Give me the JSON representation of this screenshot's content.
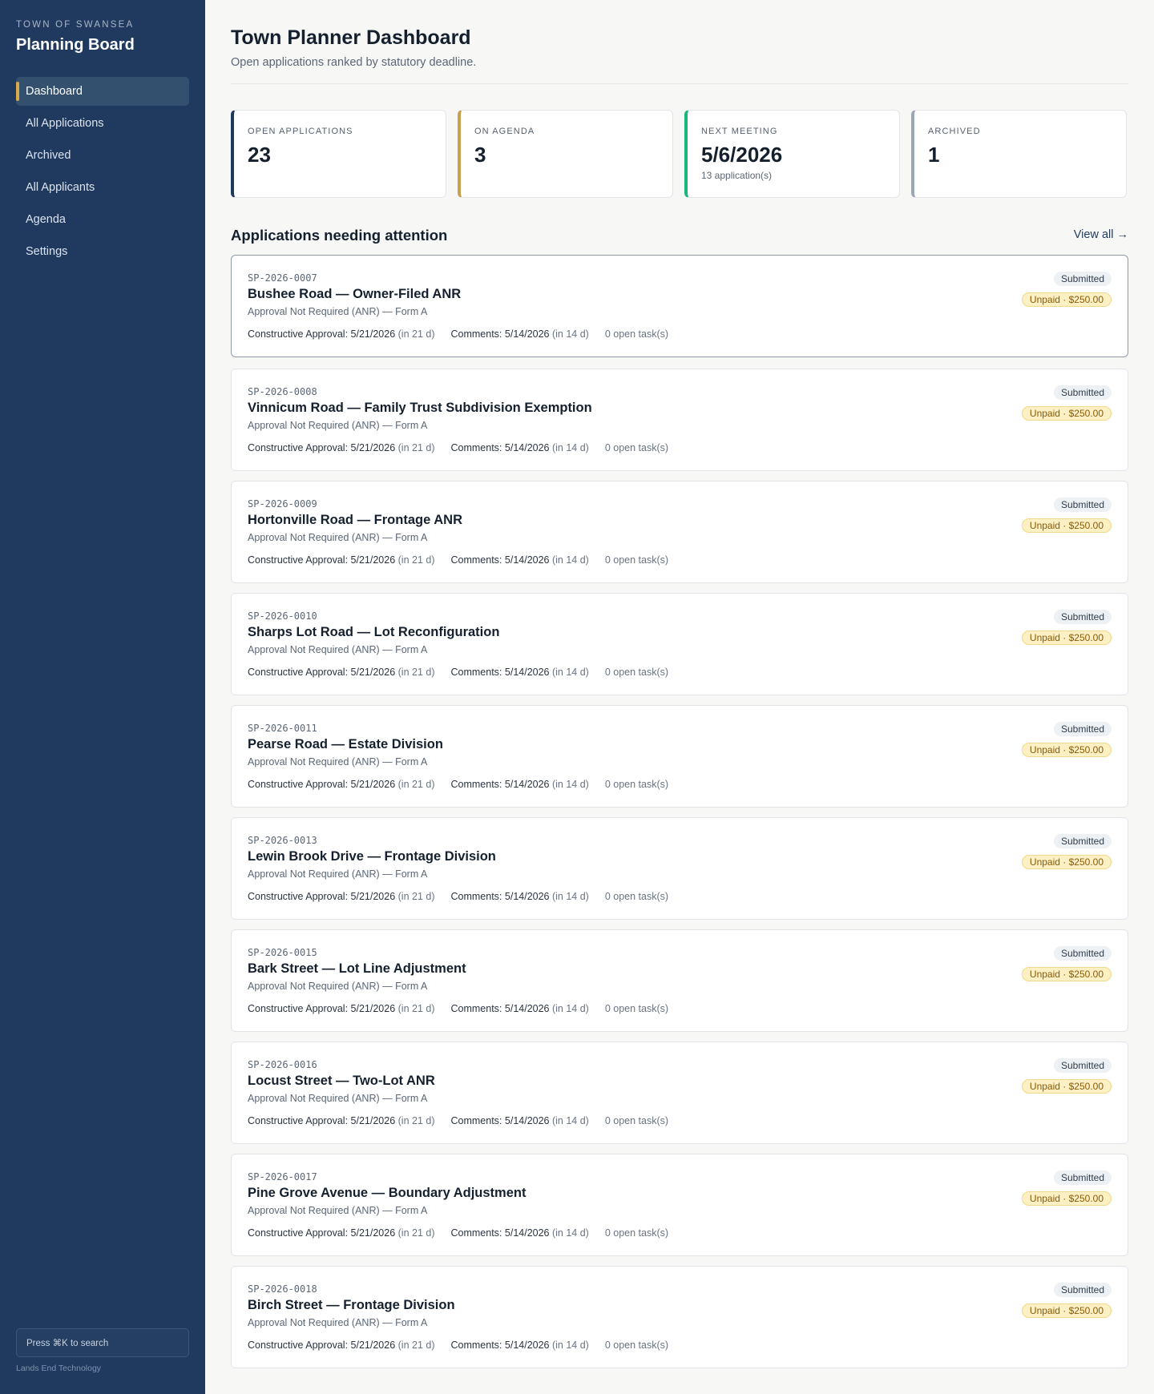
{
  "sidebar": {
    "eyebrow": "TOWN OF SWANSEA",
    "title": "Planning Board",
    "nav": [
      {
        "label": "Dashboard",
        "active": true
      },
      {
        "label": "All Applications"
      },
      {
        "label": "Archived"
      },
      {
        "label": "All Applicants"
      },
      {
        "label": "Agenda"
      },
      {
        "label": "Settings"
      }
    ],
    "search_hint": "Press ⌘K to search",
    "footer": "Lands End Technology"
  },
  "header": {
    "title": "Town Planner Dashboard",
    "subtitle": "Open applications ranked by statutory deadline."
  },
  "stats": [
    {
      "label": "OPEN APPLICATIONS",
      "value": "23",
      "sub": "",
      "color": "#1f3a5d"
    },
    {
      "label": "ON AGENDA",
      "value": "3",
      "sub": "",
      "color": "#c9a14d"
    },
    {
      "label": "NEXT MEETING",
      "value": "5/6/2026",
      "sub": "13 application(s)",
      "color": "#1ab77a"
    },
    {
      "label": "ARCHIVED",
      "value": "1",
      "sub": "",
      "color": "#9aa7b7"
    }
  ],
  "section": {
    "title": "Applications needing attention",
    "view_all": "View all →"
  },
  "applications": [
    {
      "id": "SP-2026-0007",
      "title": "Bushee Road — Owner-Filed ANR",
      "type": "Approval Not Required (ANR) — Form A",
      "ca_label": "Constructive Approval:",
      "ca_date": "5/21/2026",
      "ca_rel": "(in 21 d)",
      "c_label": "Comments:",
      "c_date": "5/14/2026",
      "c_rel": "(in 14 d)",
      "tasks": "0 open task(s)",
      "status": "Submitted",
      "fee": "Unpaid · $250.00"
    },
    {
      "id": "SP-2026-0008",
      "title": "Vinnicum Road — Family Trust Subdivision Exemption",
      "type": "Approval Not Required (ANR) — Form A",
      "ca_label": "Constructive Approval:",
      "ca_date": "5/21/2026",
      "ca_rel": "(in 21 d)",
      "c_label": "Comments:",
      "c_date": "5/14/2026",
      "c_rel": "(in 14 d)",
      "tasks": "0 open task(s)",
      "status": "Submitted",
      "fee": "Unpaid · $250.00"
    },
    {
      "id": "SP-2026-0009",
      "title": "Hortonville Road — Frontage ANR",
      "type": "Approval Not Required (ANR) — Form A",
      "ca_label": "Constructive Approval:",
      "ca_date": "5/21/2026",
      "ca_rel": "(in 21 d)",
      "c_label": "Comments:",
      "c_date": "5/14/2026",
      "c_rel": "(in 14 d)",
      "tasks": "0 open task(s)",
      "status": "Submitted",
      "fee": "Unpaid · $250.00"
    },
    {
      "id": "SP-2026-0010",
      "title": "Sharps Lot Road — Lot Reconfiguration",
      "type": "Approval Not Required (ANR) — Form A",
      "ca_label": "Constructive Approval:",
      "ca_date": "5/21/2026",
      "ca_rel": "(in 21 d)",
      "c_label": "Comments:",
      "c_date": "5/14/2026",
      "c_rel": "(in 14 d)",
      "tasks": "0 open task(s)",
      "status": "Submitted",
      "fee": "Unpaid · $250.00"
    },
    {
      "id": "SP-2026-0011",
      "title": "Pearse Road — Estate Division",
      "type": "Approval Not Required (ANR) — Form A",
      "ca_label": "Constructive Approval:",
      "ca_date": "5/21/2026",
      "ca_rel": "(in 21 d)",
      "c_label": "Comments:",
      "c_date": "5/14/2026",
      "c_rel": "(in 14 d)",
      "tasks": "0 open task(s)",
      "status": "Submitted",
      "fee": "Unpaid · $250.00"
    },
    {
      "id": "SP-2026-0013",
      "title": "Lewin Brook Drive — Frontage Division",
      "type": "Approval Not Required (ANR) — Form A",
      "ca_label": "Constructive Approval:",
      "ca_date": "5/21/2026",
      "ca_rel": "(in 21 d)",
      "c_label": "Comments:",
      "c_date": "5/14/2026",
      "c_rel": "(in 14 d)",
      "tasks": "0 open task(s)",
      "status": "Submitted",
      "fee": "Unpaid · $250.00"
    },
    {
      "id": "SP-2026-0015",
      "title": "Bark Street — Lot Line Adjustment",
      "type": "Approval Not Required (ANR) — Form A",
      "ca_label": "Constructive Approval:",
      "ca_date": "5/21/2026",
      "ca_rel": "(in 21 d)",
      "c_label": "Comments:",
      "c_date": "5/14/2026",
      "c_rel": "(in 14 d)",
      "tasks": "0 open task(s)",
      "status": "Submitted",
      "fee": "Unpaid · $250.00"
    },
    {
      "id": "SP-2026-0016",
      "title": "Locust Street — Two-Lot ANR",
      "type": "Approval Not Required (ANR) — Form A",
      "ca_label": "Constructive Approval:",
      "ca_date": "5/21/2026",
      "ca_rel": "(in 21 d)",
      "c_label": "Comments:",
      "c_date": "5/14/2026",
      "c_rel": "(in 14 d)",
      "tasks": "0 open task(s)",
      "status": "Submitted",
      "fee": "Unpaid · $250.00"
    },
    {
      "id": "SP-2026-0017",
      "title": "Pine Grove Avenue — Boundary Adjustment",
      "type": "Approval Not Required (ANR) — Form A",
      "ca_label": "Constructive Approval:",
      "ca_date": "5/21/2026",
      "ca_rel": "(in 21 d)",
      "c_label": "Comments:",
      "c_date": "5/14/2026",
      "c_rel": "(in 14 d)",
      "tasks": "0 open task(s)",
      "status": "Submitted",
      "fee": "Unpaid · $250.00"
    },
    {
      "id": "SP-2026-0018",
      "title": "Birch Street — Frontage Division",
      "type": "Approval Not Required (ANR) — Form A",
      "ca_label": "Constructive Approval:",
      "ca_date": "5/21/2026",
      "ca_rel": "(in 21 d)",
      "c_label": "Comments:",
      "c_date": "5/14/2026",
      "c_rel": "(in 14 d)",
      "tasks": "0 open task(s)",
      "status": "Submitted",
      "fee": "Unpaid · $250.00"
    }
  ]
}
